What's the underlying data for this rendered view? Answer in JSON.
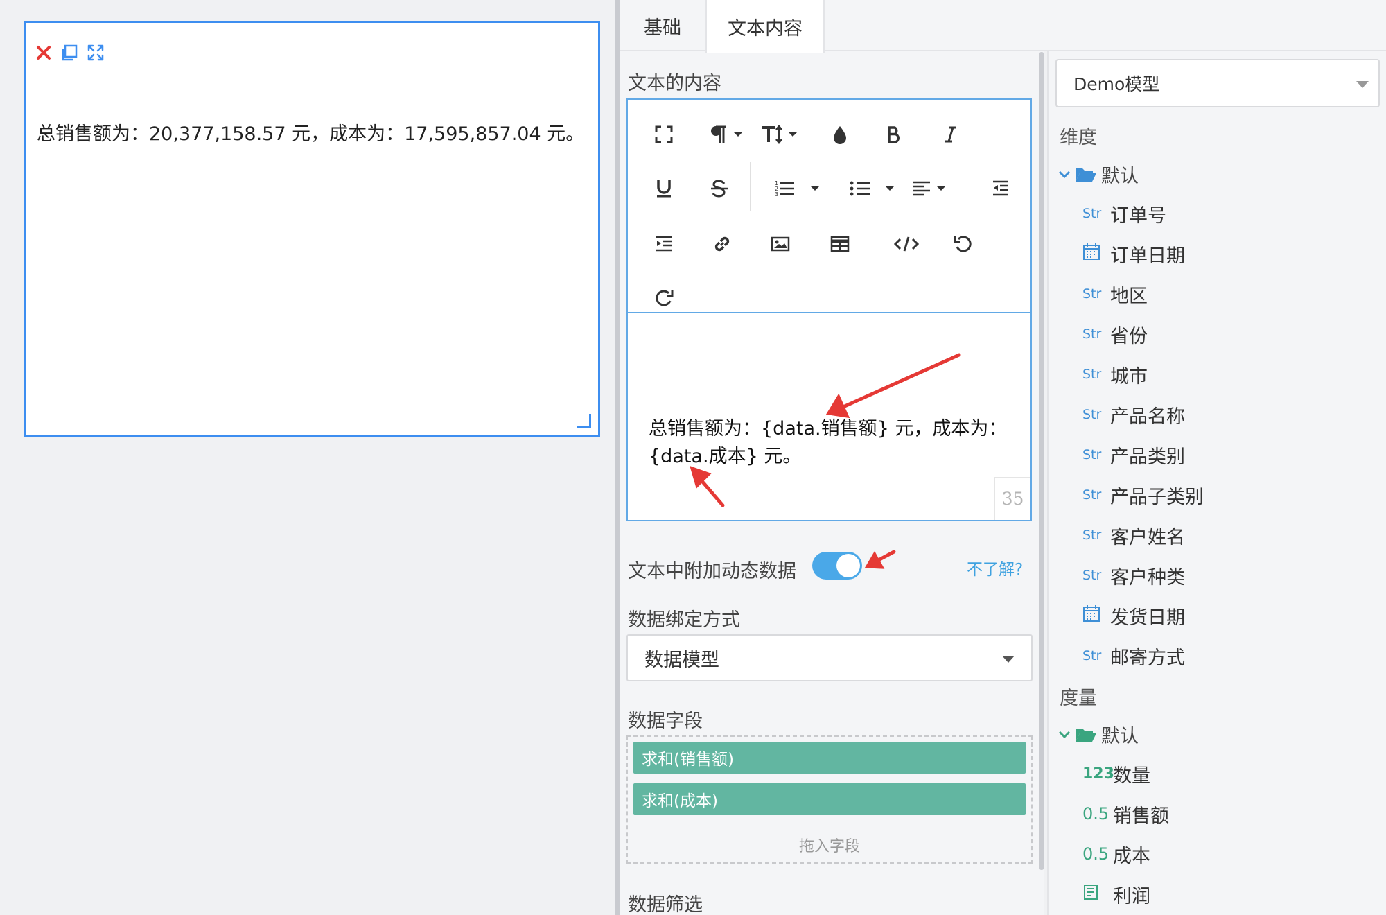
{
  "widget": {
    "text": "总销售额为：20,377,158.57 元，成本为：17,595,857.04 元。",
    "tools": [
      "close-icon",
      "copy-icon",
      "expand-icon"
    ]
  },
  "tabs": {
    "basic": "基础",
    "text_content": "文本内容"
  },
  "editor": {
    "section_label": "文本的内容",
    "content_line1": "总销售额为：{data.销售额} 元，成本为：",
    "content_line2": "{data.成本} 元。",
    "char_count": "35"
  },
  "dynamic_data": {
    "label": "文本中附加动态数据",
    "enabled": true,
    "help_link": "不了解?"
  },
  "binding": {
    "label": "数据绑定方式",
    "selected": "数据模型"
  },
  "fields": {
    "label": "数据字段",
    "items": [
      "求和(销售额)",
      "求和(成本)"
    ],
    "drop_hint": "拖入字段"
  },
  "filter": {
    "label": "数据筛选"
  },
  "model_tree": {
    "model_select": "Demo模型",
    "dimensions_title": "维度",
    "dimensions_folder": "默认",
    "dimensions": [
      {
        "type": "Str",
        "name": "订单号"
      },
      {
        "type": "date",
        "name": "订单日期"
      },
      {
        "type": "Str",
        "name": "地区"
      },
      {
        "type": "Str",
        "name": "省份"
      },
      {
        "type": "Str",
        "name": "城市"
      },
      {
        "type": "Str",
        "name": "产品名称"
      },
      {
        "type": "Str",
        "name": "产品类别"
      },
      {
        "type": "Str",
        "name": "产品子类别"
      },
      {
        "type": "Str",
        "name": "客户姓名"
      },
      {
        "type": "Str",
        "name": "客户种类"
      },
      {
        "type": "date",
        "name": "发货日期"
      },
      {
        "type": "Str",
        "name": "邮寄方式"
      }
    ],
    "measures_title": "度量",
    "measures_folder": "默认",
    "measures": [
      {
        "type": "123",
        "name": "数量"
      },
      {
        "type": "0.5",
        "name": "销售额"
      },
      {
        "type": "0.5",
        "name": "成本"
      },
      {
        "type": "calc",
        "name": "利润"
      }
    ]
  },
  "colors": {
    "accent_blue": "#3d8ef0",
    "annotation_red": "#e53935",
    "field_green": "#62b6a1",
    "toggle_on": "#4aa8e8"
  }
}
